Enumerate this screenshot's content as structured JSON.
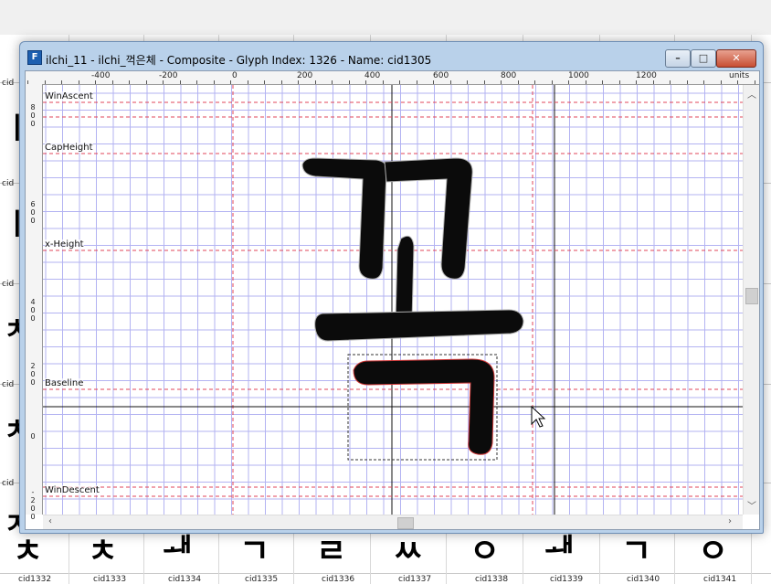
{
  "window": {
    "title": "ilchi_11 - ilchi_꺽은체 - Composite - Glyph Index: 1326 - Name: cid1305",
    "app_icon_letter": "F",
    "min_glyph": "–",
    "max_glyph": "□",
    "close_glyph": "✕"
  },
  "ruler": {
    "units_label": "units",
    "h_ticks": [
      "-400",
      "-200",
      "0",
      "200",
      "400",
      "600",
      "800",
      "1000",
      "1200"
    ],
    "v_ticks": [
      [
        "8",
        "0",
        "0"
      ],
      [
        "6",
        "0",
        "0"
      ],
      [
        "4",
        "0",
        "0"
      ],
      [
        "2",
        "0",
        "0"
      ],
      [
        "0"
      ],
      [
        "-",
        "2",
        "0",
        "0"
      ]
    ]
  },
  "metrics": {
    "win_ascent": "WinAscent",
    "cap_height": "CapHeight",
    "x_height": "x-Height",
    "baseline": "Baseline",
    "win_descent": "WinDescent"
  },
  "background_grid": {
    "row_labels": [
      "cid1332",
      "cid1333",
      "cid1334",
      "cid1335",
      "cid1336",
      "cid1337",
      "cid1338",
      "cid1339",
      "cid1340",
      "cid1341"
    ],
    "left_labels": [
      "cid",
      "cid",
      "cid",
      "cid",
      "cid"
    ],
    "bottom_glyphs": [
      "ㅊ",
      "ㅊ",
      "ᅫ",
      "ㄱ",
      "ㄹ",
      "ㅆ",
      "ㅇ",
      "ᅫ",
      "ㄱ",
      "ㅇ"
    ],
    "left_glyphs": [
      "ㅣ",
      "ㅣ",
      "ㅊ",
      "ㅊ",
      "ㅈ"
    ]
  },
  "colors": {
    "titlebar": "#b9d1ea",
    "grid_blue": "#b3b3f2",
    "metric_red": "#e0455a",
    "glyph": "#0b0b0b"
  }
}
